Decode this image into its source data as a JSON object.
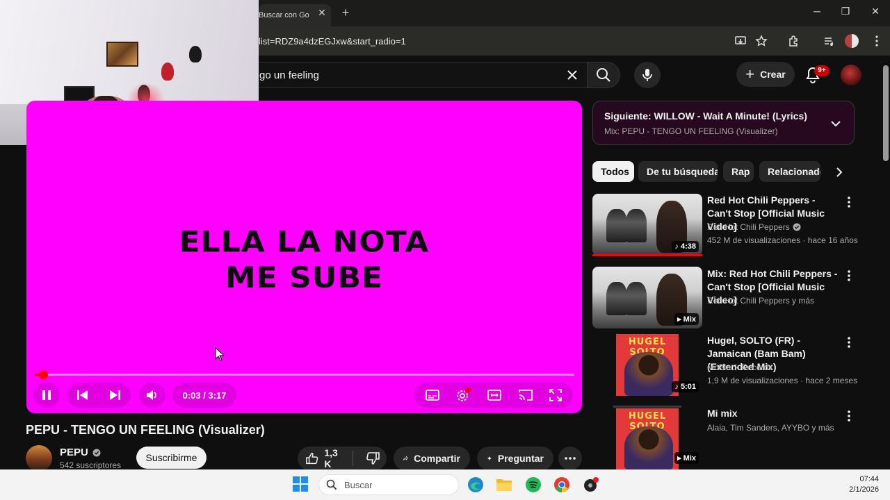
{
  "browser": {
    "tab_title": "Buscar con Go",
    "url": "list=RDZ9a4dzEGJxw&start_radio=1"
  },
  "youtube": {
    "search_query": "go un feeling",
    "create_label": "Crear",
    "notification_badge": "9+"
  },
  "player": {
    "lyric_line1": "ELLA LA NOTA",
    "lyric_line2": "ME SUBE",
    "time_display": "0:03 / 3:17",
    "progress_fraction": 0.016,
    "background_color": "#ff00ff"
  },
  "video": {
    "title": "PEPU - TENGO UN FEELING (Visualizer)",
    "channel": "PEPU",
    "subscribers": "542 suscriptores",
    "subscribe_label": "Suscribirme",
    "likes": "1,3 K",
    "share_label": "Compartir",
    "ask_label": "Preguntar"
  },
  "up_next": {
    "title": "Siguiente: WILLOW - Wait A Minute! (Lyrics)",
    "subtitle": "Mix: PEPU - TENGO UN FEELING (Visualizer)"
  },
  "chips": [
    "Todos",
    "De tu búsqueda",
    "Rap",
    "Relacionados"
  ],
  "recommendations": [
    {
      "title": "Red Hot Chili Peppers - Can't Stop [Official Music Video]",
      "channel": "Red Hot Chili Peppers",
      "stats": "452 M de visualizaciones · hace 16 años",
      "badge": "4:38"
    },
    {
      "title": "Mix: Red Hot Chili Peppers - Can't Stop [Official Music Video]",
      "channel": "Red Hot Chili Peppers y más",
      "stats": "",
      "badge": "Mix"
    },
    {
      "title": "Hugel, SOLTO (FR) - Jamaican (Bam Bam) (Extended Mix)",
      "channel": "MoBlack Records",
      "stats": "1,9 M de visualizaciones · hace 2 meses",
      "badge": "5:01",
      "thumb_text": "HUGEL SOLTO"
    },
    {
      "title": "Mi mix",
      "channel": "Alaia, Tim Sanders, AYYBO y más",
      "stats": "",
      "badge": "Mix",
      "thumb_text": "HUGEL SOLTO"
    }
  ],
  "taskbar": {
    "search_placeholder": "Buscar",
    "time": "07:44",
    "date": "2/1/2026"
  }
}
